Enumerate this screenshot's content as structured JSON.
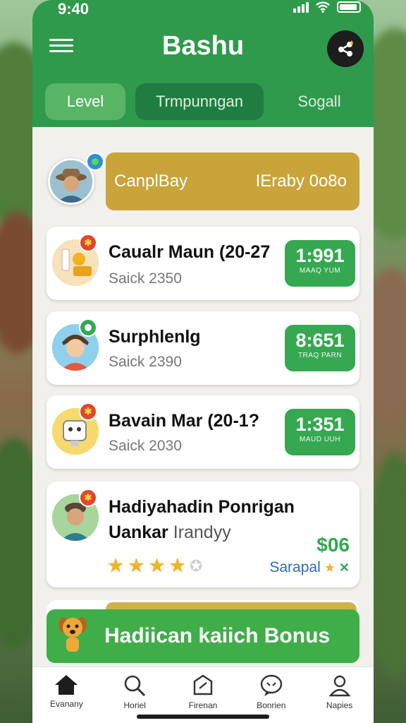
{
  "status_bar": {
    "time": "9:40"
  },
  "header": {
    "title": "Bashu",
    "menu_icon": "hamburger-icon",
    "share_icon": "share-icon"
  },
  "tabs": [
    {
      "label": "Level",
      "active": true
    },
    {
      "label": "Trmpunngan",
      "active": false
    },
    {
      "label": "Sogall",
      "active": false
    }
  ],
  "profile": {
    "name": "CanplBay",
    "value": "IEraby 0o8o"
  },
  "cards": [
    {
      "title": "Caualr Maun (20-27",
      "subtitle": "Saick 2350",
      "timer": "1:991",
      "timer_caption": "MAAQ YUM"
    },
    {
      "title": "Surphlenlg",
      "subtitle": "Saick 2390",
      "timer": "8:651",
      "timer_caption": "TRAQ PARN"
    },
    {
      "title": "Bavain Mar (20-1?",
      "subtitle": "Saick 2030",
      "timer": "1:351",
      "timer_caption": "MAUD UUH"
    },
    {
      "title": "Hadiyahadin Ponrigan",
      "title2": "Uankar",
      "title2_extra": "Irandyy",
      "price": "$06",
      "action": "Sarapal",
      "rating": 4
    }
  ],
  "bonus": {
    "label": "Hadiican kaiich Bonus"
  },
  "bottom_nav": [
    {
      "label": "Evanany",
      "icon": "home-icon"
    },
    {
      "label": "Horiel",
      "icon": "search-icon"
    },
    {
      "label": "Firenan",
      "icon": "tag-icon"
    },
    {
      "label": "Bonrien",
      "icon": "chat-icon"
    },
    {
      "label": "Napies",
      "icon": "profile-icon"
    }
  ],
  "colors": {
    "header": "#2f9a4c",
    "accent_green": "#35a851",
    "gold": "#c8a43a",
    "badge_red": "#e0472f",
    "badge_green": "#34a853"
  }
}
